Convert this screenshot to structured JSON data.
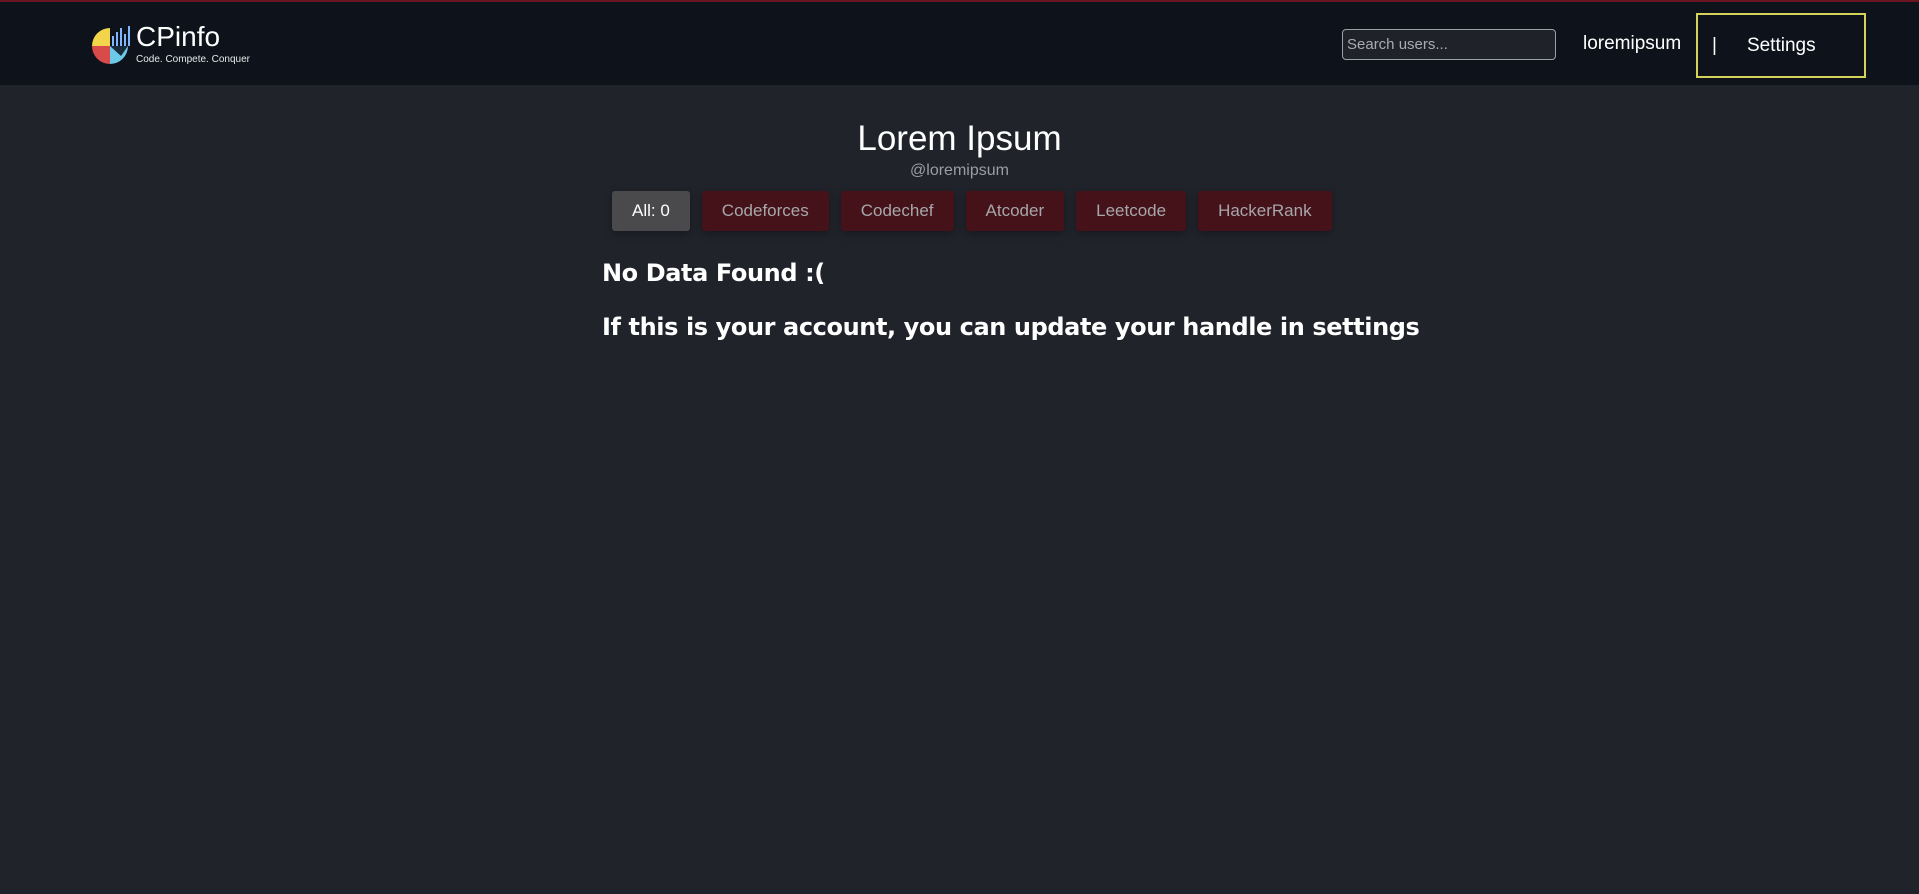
{
  "navbar": {
    "brand_name": "CPinfo",
    "brand_tagline": "Code. Compete. Conquer",
    "logo_icon": "pie-bar-chart-logo",
    "search_placeholder": "Search users...",
    "search_value": "",
    "user_link": "loremipsum",
    "separator": "|",
    "settings_label": "Settings"
  },
  "profile": {
    "name": "Lorem Ipsum",
    "handle": "@loremipsum"
  },
  "tabs": [
    {
      "label": "All: 0",
      "active": true
    },
    {
      "label": "Codeforces",
      "active": false
    },
    {
      "label": "Codechef",
      "active": false
    },
    {
      "label": "Atcoder",
      "active": false
    },
    {
      "label": "Leetcode",
      "active": false
    },
    {
      "label": "HackerRank",
      "active": false
    }
  ],
  "messages": {
    "no_data": "No Data Found :(",
    "update_hint": "If this is your account, you can update your handle in settings"
  },
  "colors": {
    "background": "#21232b",
    "navbar": "#0d121b",
    "tab_inactive": "#45121a",
    "tab_active": "#4a4a4c",
    "settings_border": "#d4d25a"
  }
}
